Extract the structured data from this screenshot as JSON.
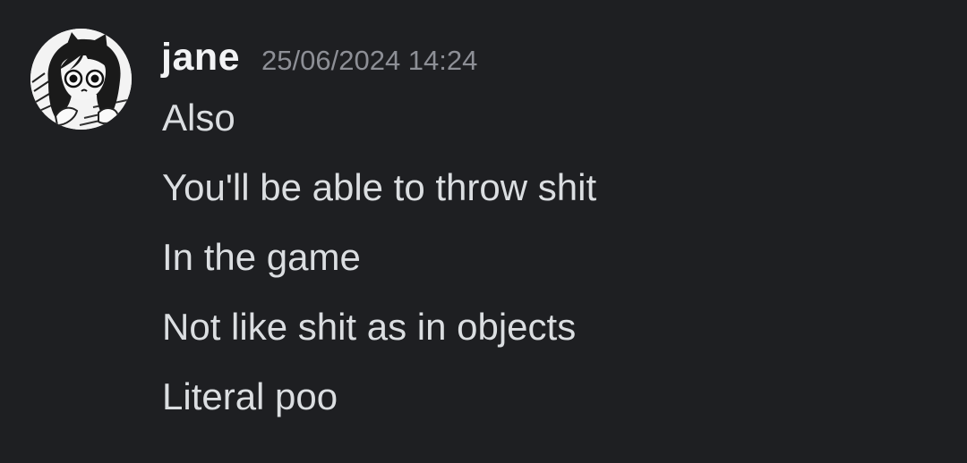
{
  "message": {
    "author": {
      "name": "jane",
      "avatar_icon": "avatar-cat-girl-icon"
    },
    "timestamp": "25/06/2024 14:24",
    "lines": [
      "Also",
      "You'll be able to throw shit",
      "In the game",
      "Not like shit as in objects",
      "Literal poo"
    ]
  },
  "colors": {
    "background": "#1e1f22",
    "username": "#f2f3f5",
    "timestamp": "#8d8f96",
    "message_text": "#dbdee1"
  }
}
